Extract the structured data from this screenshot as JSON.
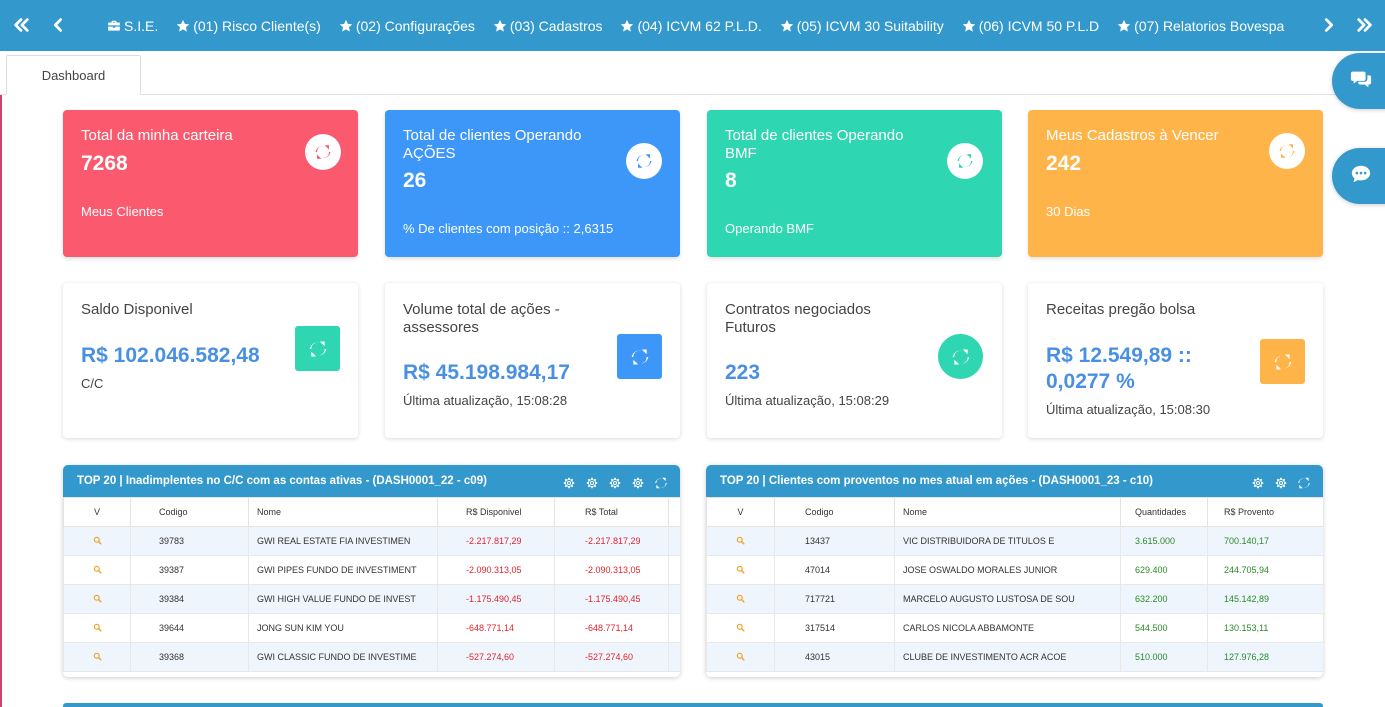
{
  "nav": {
    "items": [
      {
        "label": "S.I.E.",
        "icon": "briefcase-icon"
      },
      {
        "label": "(01) Risco Cliente(s)",
        "icon": "star-icon"
      },
      {
        "label": "(02) Configurações",
        "icon": "star-icon"
      },
      {
        "label": "(03) Cadastros",
        "icon": "star-icon"
      },
      {
        "label": "(04) ICVM 62 P.L.D.",
        "icon": "star-icon"
      },
      {
        "label": "(05) ICVM 30 Suitability",
        "icon": "star-icon"
      },
      {
        "label": "(06) ICVM 50 P.L.D",
        "icon": "star-icon"
      },
      {
        "label": "(07) Relatorios Bovespa",
        "icon": "star-icon"
      }
    ]
  },
  "tabs": {
    "dashboard": "Dashboard"
  },
  "colors": {
    "primary": "#3399cc",
    "red": "#fb5a6e",
    "blue": "#3d97f8",
    "green": "#2fd6b2",
    "orange": "#ffb44a",
    "value_blue": "#4a90e2"
  },
  "cards": {
    "carteira": {
      "title": "Total da minha carteira",
      "value": "7268",
      "sub": "Meus Clientes"
    },
    "acoes": {
      "title": "Total de clientes Operando AÇÕES",
      "value": "26",
      "sub": "% De clientes com posição :: 2,6315"
    },
    "bmf": {
      "title": "Total de clientes Operando BMF",
      "value": "8",
      "sub": "Operando BMF"
    },
    "cadastros": {
      "title": "Meus Cadastros à Vencer",
      "value": "242",
      "sub": "30 Dias"
    }
  },
  "stats": {
    "saldo": {
      "title": "Saldo Disponivel",
      "value": "R$ 102.046.582,48",
      "sub": "C/C"
    },
    "volume": {
      "title": "Volume total de ações - assessores",
      "value": "R$ 45.198.984,17",
      "sub": "Última atualização, 15:08:28"
    },
    "contratos": {
      "title": "Contratos negociados Futuros",
      "value": "223",
      "sub": "Última atualização, 15:08:29"
    },
    "receitas": {
      "title": "Receitas pregão bolsa",
      "value": "R$ 12.549,89 :: 0,0277 %",
      "sub": "Última atualização, 15:08:30"
    }
  },
  "table1": {
    "title": "TOP 20 | Inadimplentes no C/C com as contas ativas - (DASH0001_22 - c09)",
    "headers": [
      "V",
      "Codigo",
      "Nome",
      "R$ Disponivel",
      "R$ Total"
    ],
    "rows": [
      {
        "codigo": "39783",
        "nome": "GWI REAL ESTATE FIA INVESTIMEN",
        "disp": "-2.217.817,29",
        "total": "-2.217.817,29"
      },
      {
        "codigo": "39387",
        "nome": "GWI PIPES FUNDO DE INVESTIMENT",
        "disp": "-2.090.313,05",
        "total": "-2.090.313,05"
      },
      {
        "codigo": "39384",
        "nome": "GWI HIGH VALUE FUNDO DE INVEST",
        "disp": "-1.175.490,45",
        "total": "-1.175.490,45"
      },
      {
        "codigo": "39644",
        "nome": "JONG SUN KIM YOU",
        "disp": "-648.771,14",
        "total": "-648.771,14"
      },
      {
        "codigo": "39368",
        "nome": "GWI CLASSIC FUNDO DE INVESTIME",
        "disp": "-527.274,60",
        "total": "-527.274,60"
      }
    ]
  },
  "table2": {
    "title": "TOP 20 | Clientes com proventos no mes atual em ações - (DASH0001_23 - c10)",
    "headers": [
      "V",
      "Codigo",
      "Nome",
      "Quantidades",
      "R$ Provento"
    ],
    "rows": [
      {
        "codigo": "13437",
        "nome": "VIC DISTRIBUIDORA DE TITULOS E",
        "qtd": "3.615.000",
        "prov": "700.140,17"
      },
      {
        "codigo": "47014",
        "nome": "JOSE OSWALDO MORALES JUNIOR",
        "qtd": "629.400",
        "prov": "244.705,94"
      },
      {
        "codigo": "717721",
        "nome": "MARCELO AUGUSTO LUSTOSA DE SOU",
        "qtd": "632.200",
        "prov": "145.142,89"
      },
      {
        "codigo": "317514",
        "nome": "CARLOS NICOLA ABBAMONTE",
        "qtd": "544.500",
        "prov": "130.153,11"
      },
      {
        "codigo": "43015",
        "nome": "CLUBE DE INVESTIMENTO ACR ACOE",
        "qtd": "510.000",
        "prov": "127.976,28"
      }
    ]
  }
}
